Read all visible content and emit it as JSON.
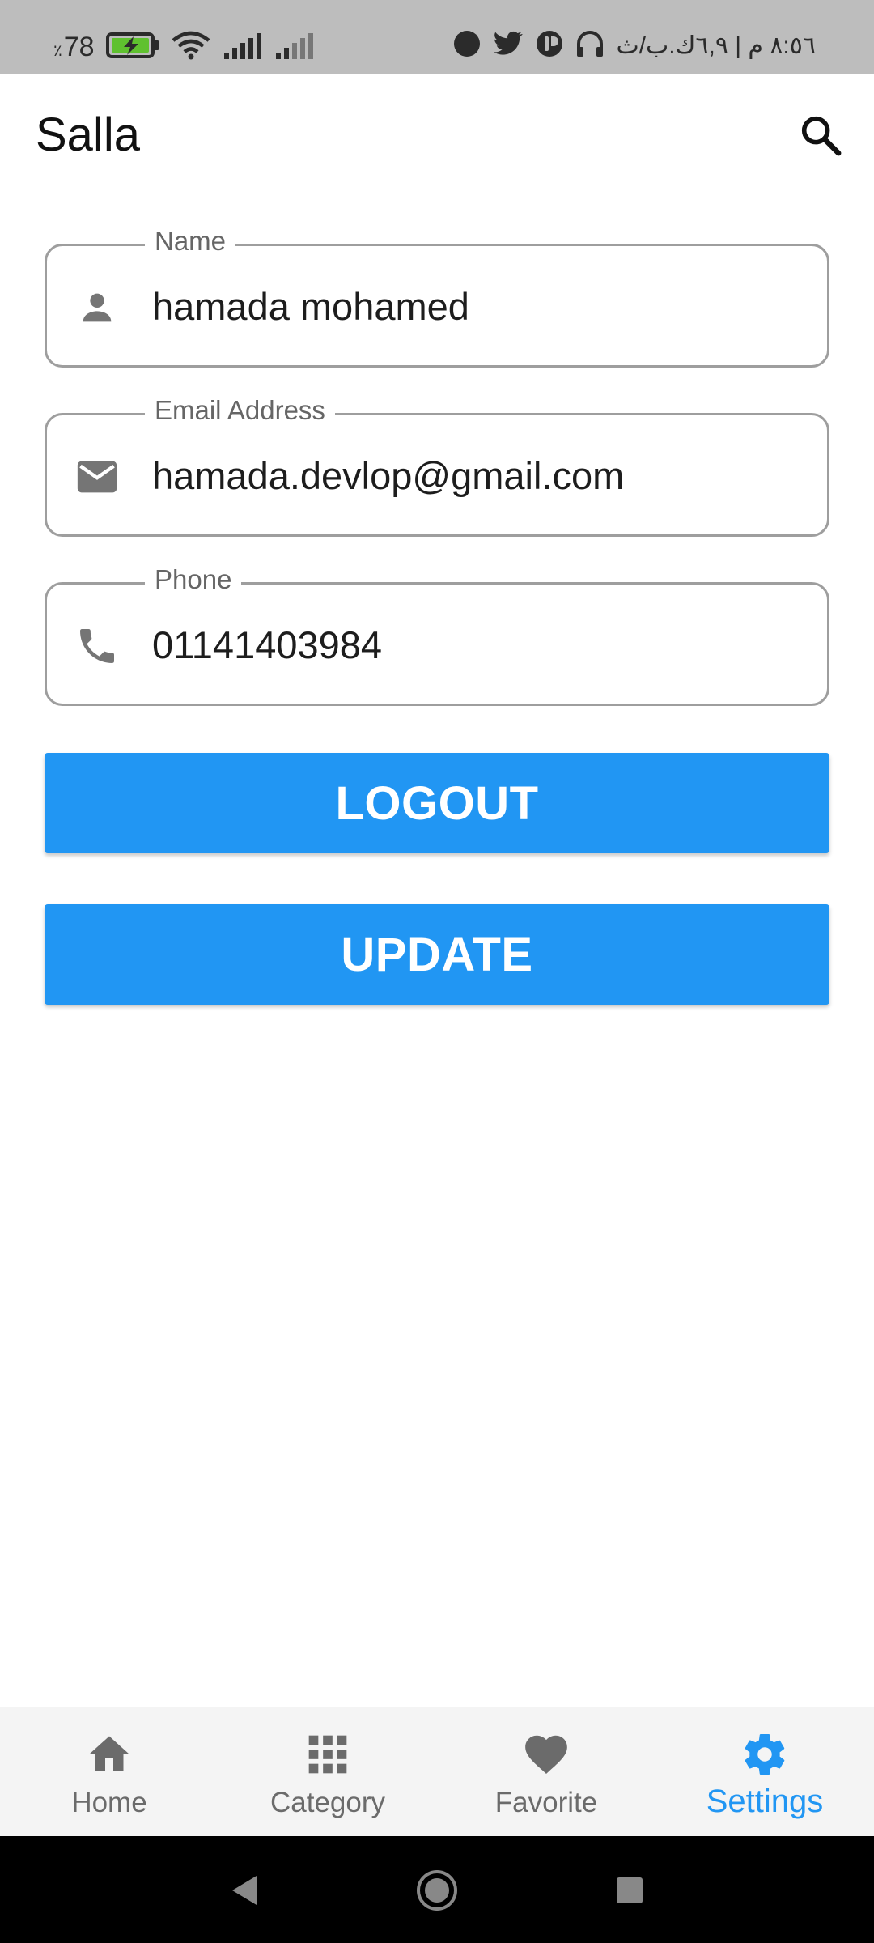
{
  "status_bar": {
    "battery_percent": "78",
    "battery_symbol": "٪",
    "time_text": "٨:٥٦ م | ٦,٩ك.ب/ث"
  },
  "app_bar": {
    "title": "Salla",
    "search_icon": "search-icon"
  },
  "form": {
    "name": {
      "label": "Name",
      "value": "hamada mohamed",
      "icon": "person-icon"
    },
    "email": {
      "label": "Email Address",
      "value": "hamada.devlop@gmail.com",
      "icon": "mail-icon"
    },
    "phone": {
      "label": "Phone",
      "value": "01141403984",
      "icon": "phone-icon"
    }
  },
  "buttons": {
    "logout": "LOGOUT",
    "update": "UPDATE"
  },
  "bottom_nav": {
    "items": [
      {
        "label": "Home",
        "icon": "home-icon"
      },
      {
        "label": "Category",
        "icon": "grid-icon"
      },
      {
        "label": "Favorite",
        "icon": "heart-icon"
      },
      {
        "label": "Settings",
        "icon": "gear-icon",
        "active": true
      }
    ]
  },
  "colors": {
    "accent": "#2196f3",
    "nav_inactive": "#6b6b6b",
    "field_border": "#9e9e9e",
    "status_bar_bg": "#bdbdbd"
  }
}
